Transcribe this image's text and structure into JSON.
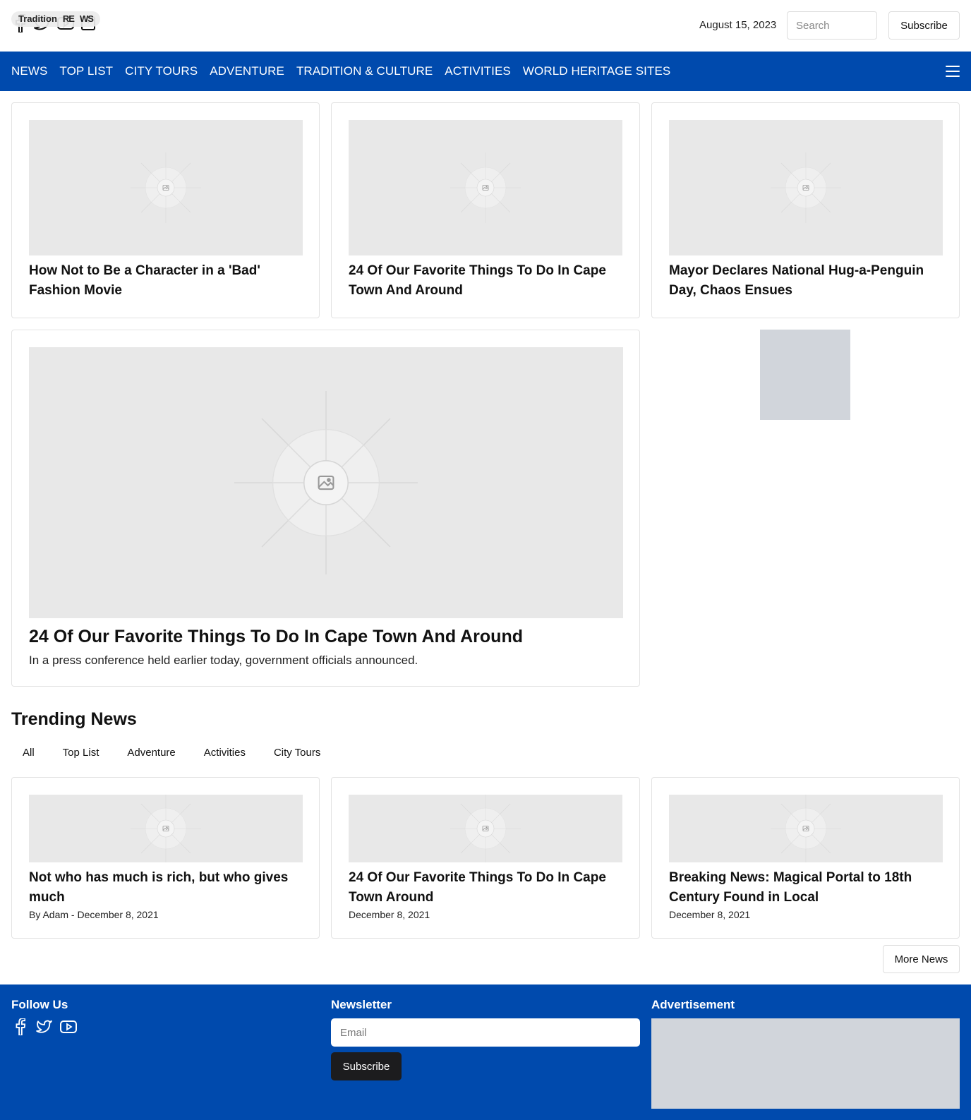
{
  "header": {
    "pill_labels": [
      "Tradition",
      "RE",
      "WS"
    ],
    "date": "August 15, 2023",
    "search_placeholder": "Search",
    "subscribe_label": "Subscribe",
    "social_icons": [
      "facebook-icon",
      "twitter-icon",
      "youtube-icon",
      "instagram-icon"
    ]
  },
  "nav": {
    "items": [
      "NEWS",
      "TOP LIST",
      "CITY TOURS",
      "ADVENTURE",
      "TRADITION & CULTURE",
      "ACTIVITIES",
      "WORLD HERITAGE SITES"
    ],
    "menu_icon": "hamburger-icon",
    "background": "#004aad"
  },
  "top_cards": [
    {
      "title": "How Not to Be a Character in a 'Bad' Fashion Movie"
    },
    {
      "title": "24 Of Our Favorite Things To Do In Cape Town And Around"
    },
    {
      "title": "Mayor Declares National Hug-a-Penguin Day, Chaos Ensues"
    }
  ],
  "featured": {
    "title": "24 Of Our Favorite Things To Do In Cape Town And Around",
    "excerpt": "In a press conference held earlier today, government officials announced."
  },
  "trending": {
    "heading": "Trending News",
    "tabs": [
      "All",
      "Top List",
      "Adventure",
      "Activities",
      "City Tours"
    ],
    "cards": [
      {
        "title": "Not who has much is rich, but who gives much",
        "meta": "By Adam - December 8, 2021"
      },
      {
        "title": "24 Of Our Favorite Things To Do In Cape Town Around",
        "meta": "December 8, 2021"
      },
      {
        "title": "Breaking News: Magical Portal to 18th Century Found in Local",
        "meta": "December 8, 2021"
      }
    ],
    "more_label": "More News"
  },
  "footer": {
    "follow_heading": "Follow Us",
    "newsletter_heading": "Newsletter",
    "email_placeholder": "Email",
    "subscribe_label": "Subscribe",
    "ad_heading": "Advertisement",
    "social_icons": [
      "facebook-icon",
      "twitter-icon",
      "youtube-icon"
    ],
    "background": "#004aad"
  }
}
